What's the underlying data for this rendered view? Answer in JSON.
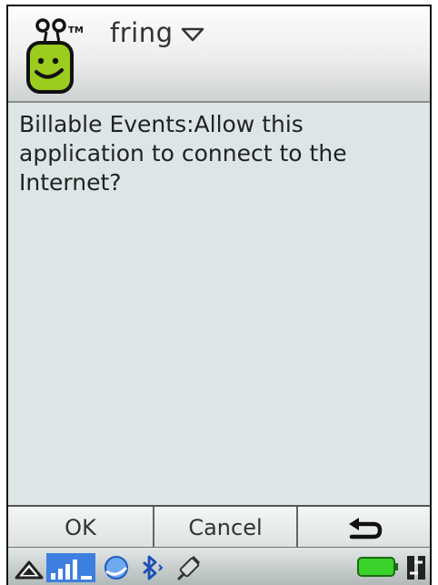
{
  "header": {
    "app_title": "fring",
    "logo_icon": "fring-logo-icon",
    "dropdown_icon": "dropdown-triangle-icon"
  },
  "dialog": {
    "message": "Billable Events:Allow this application to connect to the Internet?"
  },
  "softkeys": {
    "ok_label": "OK",
    "cancel_label": "Cancel",
    "back_icon": "back-arrow-icon"
  },
  "statusbar": {
    "icons": [
      "up-triangle-icon",
      "signal-bars-icon",
      "globe-icon",
      "bluetooth-icon",
      "usb-icon",
      "battery-icon",
      "data-transfer-icon"
    ]
  },
  "colors": {
    "content_background": "#dde6e6",
    "logo_green": "#9ccc1e",
    "text": "#222222"
  }
}
